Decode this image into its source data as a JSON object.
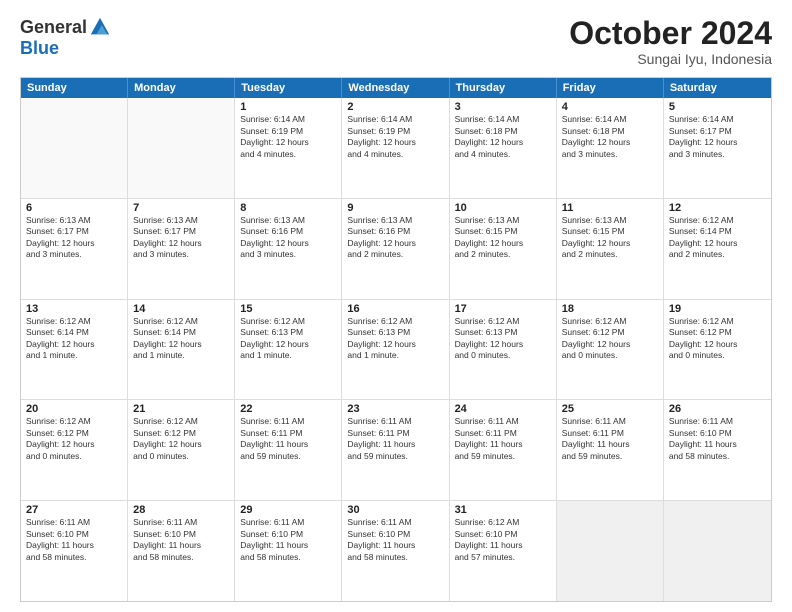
{
  "logo": {
    "general": "General",
    "blue": "Blue"
  },
  "title": "October 2024",
  "location": "Sungai Iyu, Indonesia",
  "days": [
    "Sunday",
    "Monday",
    "Tuesday",
    "Wednesday",
    "Thursday",
    "Friday",
    "Saturday"
  ],
  "rows": [
    [
      {
        "day": "",
        "text": "",
        "empty": true
      },
      {
        "day": "",
        "text": "",
        "empty": true
      },
      {
        "day": "1",
        "text": "Sunrise: 6:14 AM\nSunset: 6:19 PM\nDaylight: 12 hours\nand 4 minutes."
      },
      {
        "day": "2",
        "text": "Sunrise: 6:14 AM\nSunset: 6:19 PM\nDaylight: 12 hours\nand 4 minutes."
      },
      {
        "day": "3",
        "text": "Sunrise: 6:14 AM\nSunset: 6:18 PM\nDaylight: 12 hours\nand 4 minutes."
      },
      {
        "day": "4",
        "text": "Sunrise: 6:14 AM\nSunset: 6:18 PM\nDaylight: 12 hours\nand 3 minutes."
      },
      {
        "day": "5",
        "text": "Sunrise: 6:14 AM\nSunset: 6:17 PM\nDaylight: 12 hours\nand 3 minutes."
      }
    ],
    [
      {
        "day": "6",
        "text": "Sunrise: 6:13 AM\nSunset: 6:17 PM\nDaylight: 12 hours\nand 3 minutes."
      },
      {
        "day": "7",
        "text": "Sunrise: 6:13 AM\nSunset: 6:17 PM\nDaylight: 12 hours\nand 3 minutes."
      },
      {
        "day": "8",
        "text": "Sunrise: 6:13 AM\nSunset: 6:16 PM\nDaylight: 12 hours\nand 3 minutes."
      },
      {
        "day": "9",
        "text": "Sunrise: 6:13 AM\nSunset: 6:16 PM\nDaylight: 12 hours\nand 2 minutes."
      },
      {
        "day": "10",
        "text": "Sunrise: 6:13 AM\nSunset: 6:15 PM\nDaylight: 12 hours\nand 2 minutes."
      },
      {
        "day": "11",
        "text": "Sunrise: 6:13 AM\nSunset: 6:15 PM\nDaylight: 12 hours\nand 2 minutes."
      },
      {
        "day": "12",
        "text": "Sunrise: 6:12 AM\nSunset: 6:14 PM\nDaylight: 12 hours\nand 2 minutes."
      }
    ],
    [
      {
        "day": "13",
        "text": "Sunrise: 6:12 AM\nSunset: 6:14 PM\nDaylight: 12 hours\nand 1 minute."
      },
      {
        "day": "14",
        "text": "Sunrise: 6:12 AM\nSunset: 6:14 PM\nDaylight: 12 hours\nand 1 minute."
      },
      {
        "day": "15",
        "text": "Sunrise: 6:12 AM\nSunset: 6:13 PM\nDaylight: 12 hours\nand 1 minute."
      },
      {
        "day": "16",
        "text": "Sunrise: 6:12 AM\nSunset: 6:13 PM\nDaylight: 12 hours\nand 1 minute."
      },
      {
        "day": "17",
        "text": "Sunrise: 6:12 AM\nSunset: 6:13 PM\nDaylight: 12 hours\nand 0 minutes."
      },
      {
        "day": "18",
        "text": "Sunrise: 6:12 AM\nSunset: 6:12 PM\nDaylight: 12 hours\nand 0 minutes."
      },
      {
        "day": "19",
        "text": "Sunrise: 6:12 AM\nSunset: 6:12 PM\nDaylight: 12 hours\nand 0 minutes."
      }
    ],
    [
      {
        "day": "20",
        "text": "Sunrise: 6:12 AM\nSunset: 6:12 PM\nDaylight: 12 hours\nand 0 minutes."
      },
      {
        "day": "21",
        "text": "Sunrise: 6:12 AM\nSunset: 6:12 PM\nDaylight: 12 hours\nand 0 minutes."
      },
      {
        "day": "22",
        "text": "Sunrise: 6:11 AM\nSunset: 6:11 PM\nDaylight: 11 hours\nand 59 minutes."
      },
      {
        "day": "23",
        "text": "Sunrise: 6:11 AM\nSunset: 6:11 PM\nDaylight: 11 hours\nand 59 minutes."
      },
      {
        "day": "24",
        "text": "Sunrise: 6:11 AM\nSunset: 6:11 PM\nDaylight: 11 hours\nand 59 minutes."
      },
      {
        "day": "25",
        "text": "Sunrise: 6:11 AM\nSunset: 6:11 PM\nDaylight: 11 hours\nand 59 minutes."
      },
      {
        "day": "26",
        "text": "Sunrise: 6:11 AM\nSunset: 6:10 PM\nDaylight: 11 hours\nand 58 minutes."
      }
    ],
    [
      {
        "day": "27",
        "text": "Sunrise: 6:11 AM\nSunset: 6:10 PM\nDaylight: 11 hours\nand 58 minutes."
      },
      {
        "day": "28",
        "text": "Sunrise: 6:11 AM\nSunset: 6:10 PM\nDaylight: 11 hours\nand 58 minutes."
      },
      {
        "day": "29",
        "text": "Sunrise: 6:11 AM\nSunset: 6:10 PM\nDaylight: 11 hours\nand 58 minutes."
      },
      {
        "day": "30",
        "text": "Sunrise: 6:11 AM\nSunset: 6:10 PM\nDaylight: 11 hours\nand 58 minutes."
      },
      {
        "day": "31",
        "text": "Sunrise: 6:12 AM\nSunset: 6:10 PM\nDaylight: 11 hours\nand 57 minutes."
      },
      {
        "day": "",
        "text": "",
        "empty": true,
        "shaded": true
      },
      {
        "day": "",
        "text": "",
        "empty": true,
        "shaded": true
      }
    ]
  ]
}
